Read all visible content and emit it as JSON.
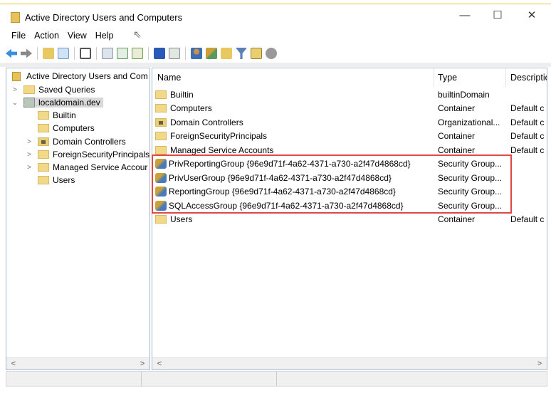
{
  "window": {
    "title": "Active Directory Users and Computers",
    "controls": [
      "—",
      "☐",
      "✕"
    ]
  },
  "menu": [
    "File",
    "Action",
    "View",
    "Help"
  ],
  "toolbar": {
    "icons": [
      "back-icon",
      "forward-icon",
      "up-folder-icon",
      "show-hide-console-tree-icon",
      "clipboard-icon",
      "properties-icon",
      "refresh-icon",
      "export-list-icon",
      "help-icon",
      "show-action-pane-icon",
      "new-user-icon",
      "new-group-icon",
      "new-ou-icon",
      "filter-icon",
      "find-icon",
      "add-to-group-icon"
    ]
  },
  "tree": {
    "root": "Active Directory Users and Com",
    "items": [
      {
        "label": "Saved Queries",
        "level": 1,
        "expander": "collapsed"
      },
      {
        "label": "localdomain.dev",
        "level": 1,
        "expander": "expanded",
        "selected": true
      },
      {
        "label": "Builtin",
        "level": 2,
        "expander": "none"
      },
      {
        "label": "Computers",
        "level": 2,
        "expander": "none"
      },
      {
        "label": "Domain Controllers",
        "level": 2,
        "expander": "collapsed"
      },
      {
        "label": "ForeignSecurityPrincipals",
        "level": 2,
        "expander": "collapsed"
      },
      {
        "label": "Managed Service Accour",
        "level": 2,
        "expander": "collapsed"
      },
      {
        "label": "Users",
        "level": 2,
        "expander": "none"
      }
    ]
  },
  "list": {
    "columns": [
      "Name",
      "Type",
      "Descriptio"
    ],
    "rows": [
      {
        "name": "Builtin",
        "type": "builtinDomain",
        "desc": "",
        "icon": "folder"
      },
      {
        "name": "Computers",
        "type": "Container",
        "desc": "Default c",
        "icon": "folder"
      },
      {
        "name": "Domain Controllers",
        "type": "Organizational...",
        "desc": "Default c",
        "icon": "ou"
      },
      {
        "name": "ForeignSecurityPrincipals",
        "type": "Container",
        "desc": "Default c",
        "icon": "folder"
      },
      {
        "name": "Managed Service Accounts",
        "type": "Container",
        "desc": "Default c",
        "icon": "folder"
      },
      {
        "name": "PrivReportingGroup {96e9d71f-4a62-4371-a730-a2f47d4868cd}",
        "type": "Security Group...",
        "desc": "",
        "icon": "group"
      },
      {
        "name": "PrivUserGroup {96e9d71f-4a62-4371-a730-a2f47d4868cd}",
        "type": "Security Group...",
        "desc": "",
        "icon": "group"
      },
      {
        "name": "ReportingGroup {96e9d71f-4a62-4371-a730-a2f47d4868cd}",
        "type": "Security Group...",
        "desc": "",
        "icon": "group"
      },
      {
        "name": "SQLAccessGroup {96e9d71f-4a62-4371-a730-a2f47d4868cd}",
        "type": "Security Group...",
        "desc": "",
        "icon": "group"
      },
      {
        "name": "Users",
        "type": "Container",
        "desc": "Default c",
        "icon": "folder"
      }
    ]
  },
  "colors": {
    "highlight": "#e04848",
    "folder": "#f2d98a"
  }
}
